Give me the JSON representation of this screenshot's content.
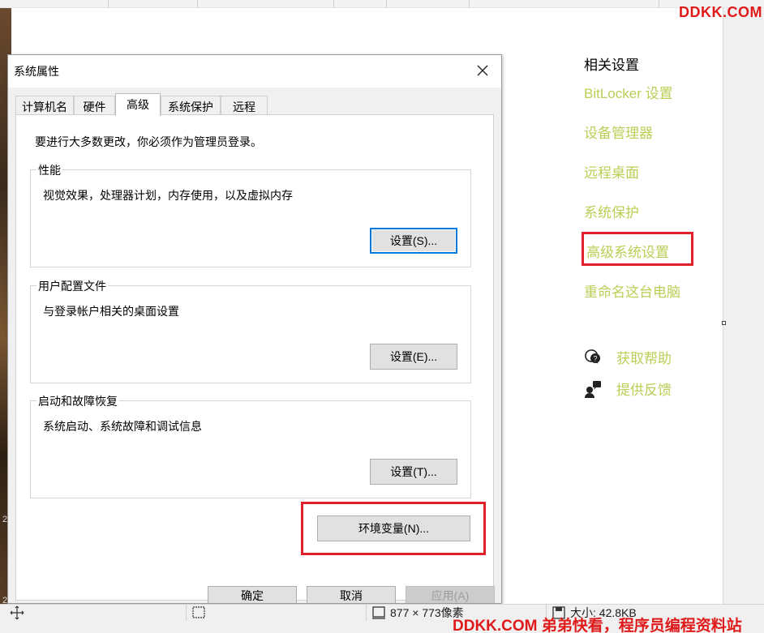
{
  "watermark": {
    "top": "DDKK.COM",
    "bottom": "DDKK.COM 弟弟快看，程序员编程资料站"
  },
  "related_settings": {
    "title": "相关设置",
    "links": [
      "BitLocker 设置",
      "设备管理器",
      "远程桌面",
      "系统保护",
      "高级系统设置",
      "重命名这台电脑"
    ],
    "help": "获取帮助",
    "feedback": "提供反馈",
    "link_color": "#b9cf55",
    "highlight_color": "#e0202a"
  },
  "dialog": {
    "title": "系统属性",
    "tabs": [
      "计算机名",
      "硬件",
      "高级",
      "系统保护",
      "远程"
    ],
    "active_tab": "高级",
    "notice": "要进行大多数更改，你必须作为管理员登录。",
    "performance": {
      "legend": "性能",
      "description": "视觉效果，处理器计划，内存使用，以及虚拟内存",
      "button": "设置(S)..."
    },
    "user_profiles": {
      "legend": "用户配置文件",
      "description": "与登录帐户相关的桌面设置",
      "button": "设置(E)..."
    },
    "startup_recovery": {
      "legend": "启动和故障恢复",
      "description": "系统启动、系统故障和调试信息",
      "button": "设置(T)..."
    },
    "env_button": "环境变量(N)...",
    "ok": "确定",
    "cancel": "取消",
    "apply": "应用(A)"
  },
  "statusbar": {
    "dimensions": "877 × 773像素",
    "size": "大小: 42.8KB"
  }
}
